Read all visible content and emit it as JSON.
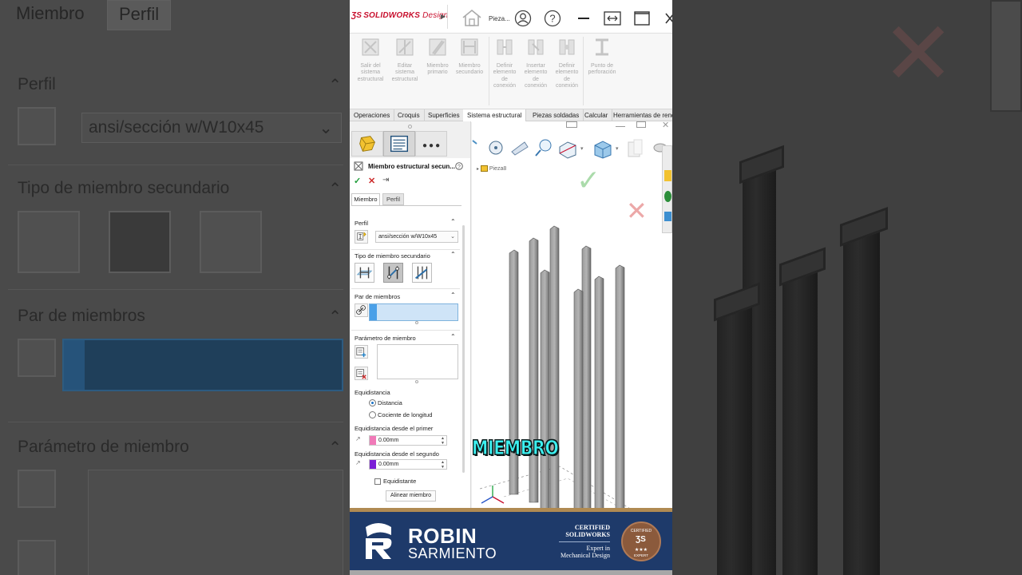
{
  "app": {
    "logo_text": "SOLIDWORKS",
    "logo_suffix": "Design",
    "document_title": "Pieza..."
  },
  "command_manager": {
    "items": [
      {
        "label_lines": [
          "Salir del",
          "sistema",
          "estructural"
        ]
      },
      {
        "label_lines": [
          "Editar",
          "sistema",
          "estructural"
        ]
      },
      {
        "label_lines": [
          "Miembro",
          "primario"
        ]
      },
      {
        "label_lines": [
          "Miembro",
          "secundario"
        ]
      },
      {
        "label_lines": [
          "Definir",
          "elemento",
          "de",
          "conexión"
        ]
      },
      {
        "label_lines": [
          "Insertar",
          "elemento",
          "de",
          "conexión"
        ]
      },
      {
        "label_lines": [
          "Definir",
          "elemento",
          "de",
          "conexión"
        ]
      },
      {
        "label_lines": [
          "Punto de",
          "perforación"
        ]
      }
    ]
  },
  "tabs": [
    {
      "label": "Operaciones"
    },
    {
      "label": "Croquis"
    },
    {
      "label": "Superficies"
    },
    {
      "label": "Sistema estructural",
      "active": true
    },
    {
      "label": "Piezas soldadas"
    },
    {
      "label": "Calcular"
    },
    {
      "label": "Herramientas de rend"
    }
  ],
  "property_manager": {
    "title": "Miembro estructural secun...",
    "subtabs": [
      "Miembro",
      "Perfil"
    ],
    "profile": {
      "header": "Perfil",
      "value": "ansi/sección w/W10x45"
    },
    "member_type": {
      "header": "Tipo de miembro secundario"
    },
    "member_pair": {
      "header": "Par de miembros"
    },
    "member_param": {
      "header": "Parámetro de miembro"
    },
    "offset": {
      "label": "Equidistancia",
      "options": [
        "Distancia",
        "Cociente de longitud"
      ],
      "selected": "Distancia",
      "from_first_label": "Equidistancia desde el primer",
      "from_first_value": "0.00mm",
      "from_second_label": "Equidistancia desde el segundo",
      "from_second_value": "0.00mm",
      "equidistant_label": "Equidistante",
      "equidistant_checked": false,
      "align_button": "Alinear miembro"
    }
  },
  "feature_tree": {
    "node": "Pieza8"
  },
  "overlay_caption": "MIEMBRO",
  "background_zoom": {
    "tabs": [
      "Miembro",
      "Perfil"
    ],
    "profile_header": "Perfil",
    "profile_value": "ansi/sección w/W10x45",
    "type_header": "Tipo de miembro secundario",
    "pair_header": "Par de miembros",
    "param_header": "Parámetro de miembro"
  },
  "banner": {
    "name": "ROBIN",
    "surname": "SARMIENTO",
    "cert_line1": "CERTIFIED",
    "cert_line2": "SOLIDWORKS",
    "cert_line3": "Expert in",
    "cert_line4": "Mechanical Design",
    "badge_top": "CERTIFIED",
    "badge_mid": "★★★",
    "badge_bottom": "EXPERT"
  },
  "colors": {
    "solidworks_red": "#c8102e",
    "accept_green": "#1f9d3a",
    "cancel_red": "#cc2a2a",
    "selection_blue": "#cfe4f7",
    "banner_navy": "#1e3a6a",
    "banner_gold": "#b08a52",
    "caption_cyan": "#3cf0f0",
    "offset1_swatch": "#f07ab8",
    "offset2_swatch": "#7a1fd6"
  }
}
